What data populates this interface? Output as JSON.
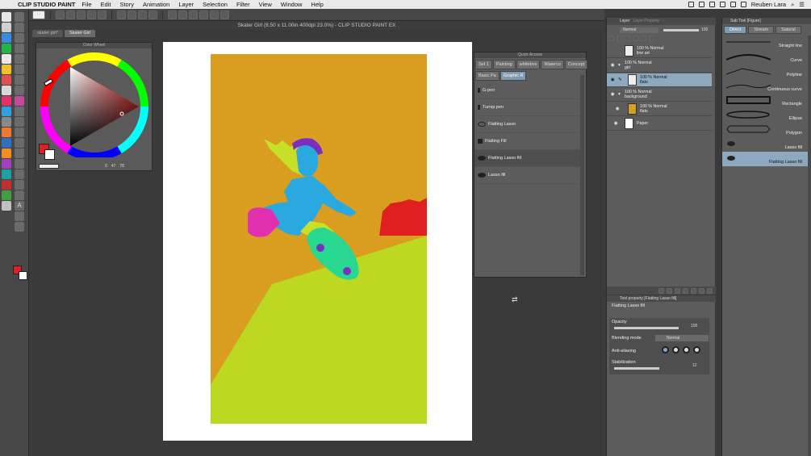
{
  "menubar": {
    "app_name": "CLIP STUDIO PAINT",
    "items": [
      "File",
      "Edit",
      "Story",
      "Animation",
      "Layer",
      "Selection",
      "Filter",
      "View",
      "Window",
      "Help"
    ],
    "user_name": "Reuben Lara"
  },
  "document": {
    "title": "Skater Girl (8.50 x 11.00in 400dpi 23.0%)  - CLIP STUDIO PAINT EX",
    "tabs": [
      "skater girl*",
      "Skater Girl"
    ]
  },
  "color_wheel": {
    "title": "Color Wheel",
    "values": [
      "0",
      "47",
      "78"
    ]
  },
  "quick_access": {
    "title": "Quick Access",
    "tabs_row1": [
      "Set 1",
      "Painting",
      "whitebox",
      "Waterco",
      "Concept"
    ],
    "tabs_row2": [
      "Basic Pa",
      "Graphic R"
    ],
    "items": [
      "G-pen",
      "Turnip pen",
      "Flatting Lasso",
      "Flatting Fill",
      "Flatting Lasso fill",
      "Lasso fill"
    ]
  },
  "layer_panel": {
    "tabs": [
      "Layer",
      "Layer Property"
    ],
    "blend_mode": "Normal",
    "opacity": "100",
    "layers": [
      {
        "line1": "100 % Normal",
        "line2": "line art"
      },
      {
        "line1": "100 % Normal",
        "line2": "girl"
      },
      {
        "line1": "100 % Normal",
        "line2": "flats"
      },
      {
        "line1": "100 % Normal",
        "line2": "background"
      },
      {
        "line1": "100 % Normal",
        "line2": "flats"
      },
      {
        "line1": "",
        "line2": "Paper"
      }
    ]
  },
  "tool_property": {
    "title": "Tool property [Flatting Lasso fill]",
    "tool_name": "Flatting Lasso fill",
    "opacity_label": "Opacity",
    "opacity_value": "100",
    "blending_label": "Blending mode",
    "blending_value": "Normal",
    "antialias_label": "Anti-aliasing",
    "stabilization_label": "Stabilization",
    "stabilization_value": "12"
  },
  "sub_tool": {
    "title": "Sub Tool [Figure]",
    "tabs": [
      "Direct",
      "Stream",
      "Saturat"
    ],
    "items": [
      "Straight line",
      "Curve",
      "Polyline",
      "Continuous curve",
      "Rectangle",
      "Ellipse",
      "Polygon",
      "Lasso fill",
      "Flatting Lasso fill"
    ]
  },
  "colors": {
    "background": "#d99e20",
    "hill": "#bcd820",
    "girl_blue": "#2aa8e0",
    "skate_green": "#28d890",
    "accent_purple": "#7a2fc0",
    "hair_yellow": "#c8e028",
    "skirt_pink": "#e030b0",
    "bush_red": "#e02020",
    "selected_blue": "#8ea9bf",
    "fg_color": "#e02020",
    "bg_color": "#ffffff"
  }
}
